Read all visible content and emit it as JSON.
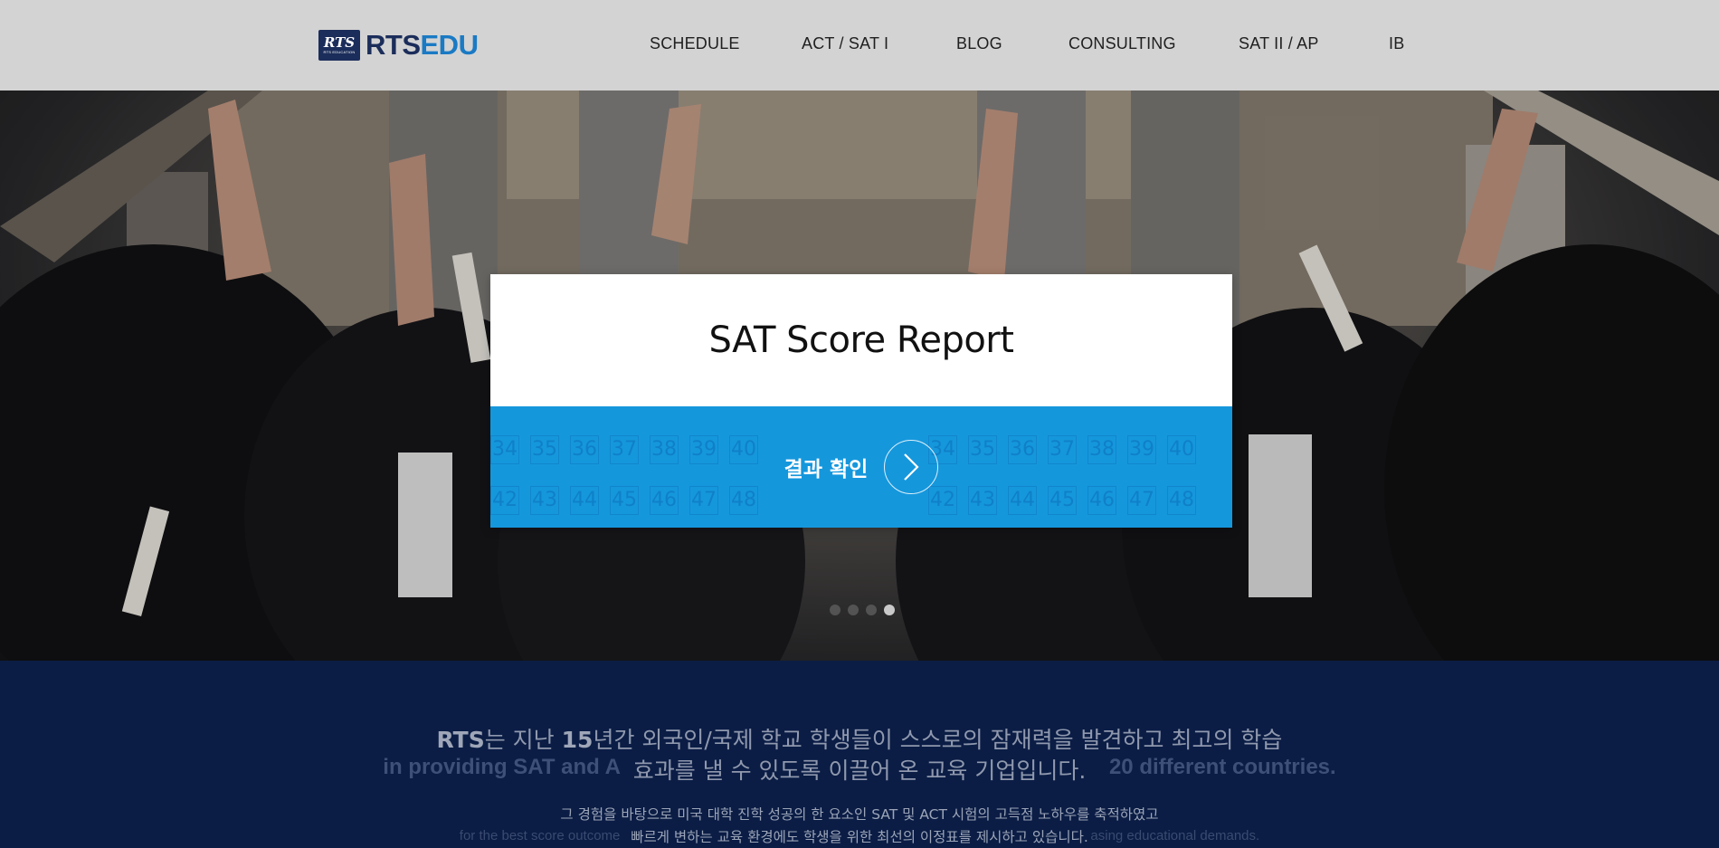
{
  "header": {
    "logo": {
      "mark": "RTS",
      "mark_sub": "RTS EDUCATION",
      "text_a": "RTS",
      "text_b": "EDU"
    },
    "nav": [
      "SCHEDULE",
      "ACT / SAT I",
      "BLOG",
      "CONSULTING",
      "SAT II / AP",
      "IB"
    ]
  },
  "colors": {
    "header_bg": "#d3d3d3",
    "brand_navy": "#1b2d5a",
    "brand_blue": "#1a7ac4",
    "cta_blue": "#1597dc",
    "section_navy": "#0b1d45"
  },
  "hero": {
    "card_title": "SAT Score Report",
    "cta_label": "결과 확인",
    "cta_icon": "chevron-right-icon",
    "grid_numbers_row1": [
      "34",
      "35",
      "36",
      "37",
      "38",
      "39",
      "40",
      "34",
      "35",
      "36",
      "37",
      "38",
      "39",
      "40"
    ],
    "grid_numbers_row2": [
      "42",
      "43",
      "44",
      "45",
      "46",
      "47",
      "48",
      "42",
      "43",
      "44",
      "45",
      "46",
      "47",
      "48"
    ],
    "slides_total": 4,
    "active_slide": 4
  },
  "intro": {
    "ko_line1_strong": "RTS",
    "ko_line1_a": "는 지난 ",
    "ko_line1_num": "15",
    "ko_line1_b": "년간 외국인/국제 학교 학생들이 스스로의 잠재력을 발견하고 최고의 학습",
    "en_line_a": "in providing SAT and A",
    "en_line_b": "20 different countries.",
    "ko_line2": "효과를 낼 수 있도록 이끌어 온 교육 기업입니다.",
    "ko_small1": "그 경험을 바탕으로 미국 대학 진학 성공의 한 요소인 SAT 및 ACT 시험의 고득점 노하우를 축적하였고",
    "en_small_a": "for the best score outcome",
    "en_small_b": "asing educational demands.",
    "ko_small2": "빠르게 변하는 교육 환경에도 학생을 위한 최선의 이정표를 제시하고 있습니다."
  }
}
